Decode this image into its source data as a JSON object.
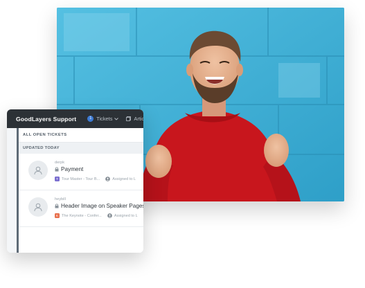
{
  "app": {
    "name": "GoodLayers Support"
  },
  "nav": {
    "tickets_count": "1",
    "tickets_label": "Tickets",
    "articles_label": "Artic"
  },
  "list": {
    "heading": "ALL OPEN TICKETS",
    "group": "UPDATED TODAY"
  },
  "tickets": [
    {
      "user": "derpk",
      "title": "Payment",
      "product": "Tour Master - Tour B...",
      "product_icon_color": "#7b6fd0",
      "assigned": "Assigned to L"
    },
    {
      "user": "heybill",
      "title": "Header Image on Speaker Pages",
      "product": "The Keynote - Confer...",
      "product_icon_color": "#e8704d",
      "assigned": "Assigned to L"
    }
  ],
  "colors": {
    "topbar": "#2c3136",
    "accent": "#3d7bd4",
    "photo_wall": "#3fb1d6",
    "sweater": "#c8161d"
  }
}
